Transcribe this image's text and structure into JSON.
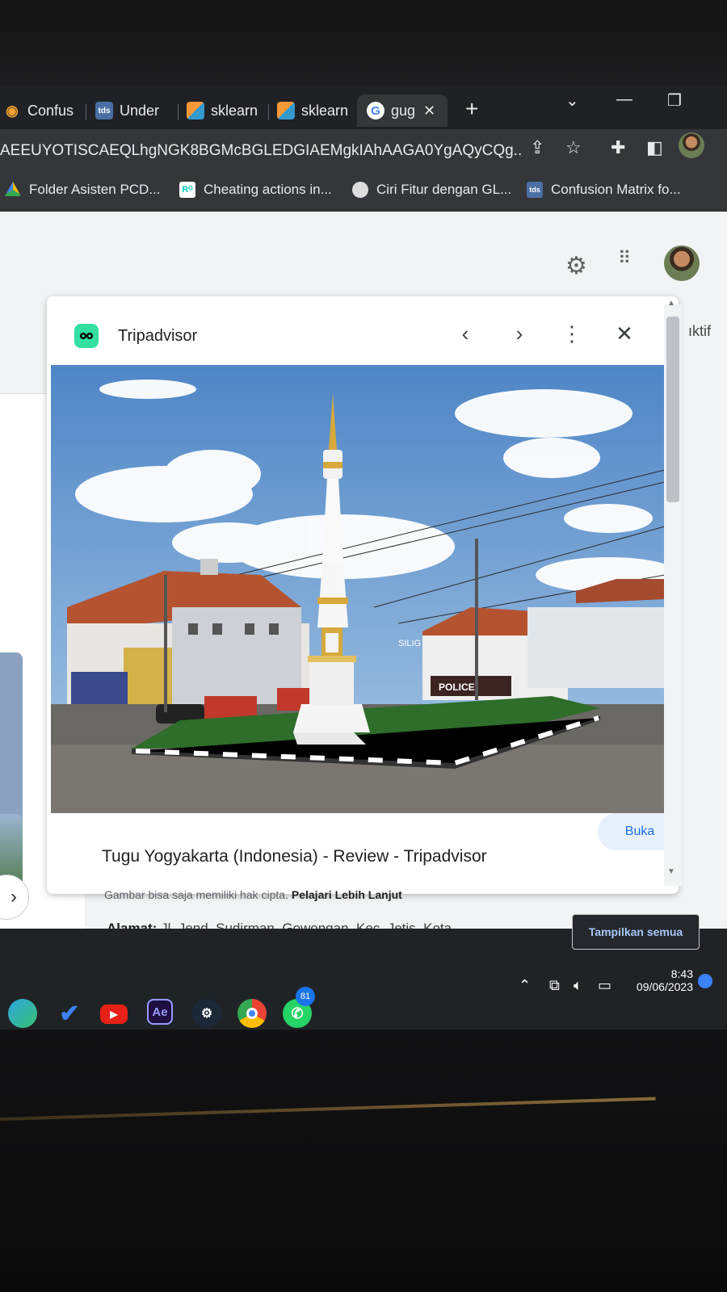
{
  "browser": {
    "tabs": [
      {
        "label": "Confus",
        "icon": "eye-icon"
      },
      {
        "label": "Under",
        "icon": "tds-icon"
      },
      {
        "label": "sklearn",
        "icon": "sklearn-icon"
      },
      {
        "label": "sklearn",
        "icon": "sklearn-icon"
      },
      {
        "label": "gug",
        "icon": "google-icon",
        "active": true
      }
    ],
    "url": "AEEUYOTISCAEQLhgNGK8BGMcBGLEDGIAEMgkIAhAAGA0YgAQyCQg...",
    "bookmarks": [
      {
        "label": "Folder Asisten PCD...",
        "icon": "drive-icon"
      },
      {
        "label": "Cheating actions in...",
        "icon": "researchgate-icon"
      },
      {
        "label": "Ciri Fitur dengan GL...",
        "icon": "page-icon"
      },
      {
        "label": "Confusion Matrix fo...",
        "icon": "tds-icon"
      }
    ]
  },
  "page": {
    "side_text": "ıktif",
    "panel": {
      "source": "Tripadvisor",
      "title": "Tugu Yogyakarta (Indonesia) - Review - Tripadvisor",
      "visit_label": "Buka",
      "copyright_note": "Gambar bisa saja memiliki hak cipta.",
      "learn_more": "Pelajari Lebih Lanjut",
      "photo_signs": {
        "silig": "SILIG",
        "police": "POLICE"
      }
    },
    "address_label": "Alamat:",
    "address_value": " Jl. Jend. Sudirman, Gowongan, Kec. Jetis, Kota",
    "show_all": "Tampilkan semua"
  },
  "taskbar": {
    "apps": [
      "edge-icon",
      "todo-icon",
      "youtube-icon",
      "after-effects-icon",
      "steam-icon",
      "chrome-icon",
      "whatsapp-icon"
    ],
    "ae_label": "Ae",
    "whatsapp_badge": "81",
    "time": "8:43",
    "date": "09/06/2023"
  },
  "colors": {
    "accent": "#1a73e8",
    "tripadvisor": "#34e0a1",
    "chrome_dark": "#202124"
  }
}
